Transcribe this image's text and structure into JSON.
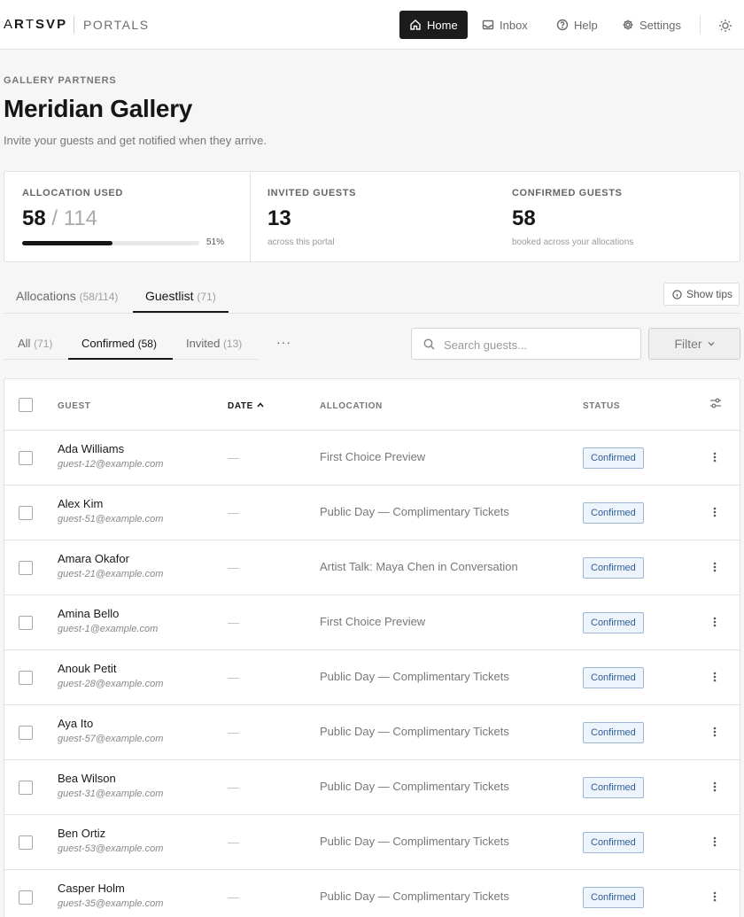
{
  "brand": {
    "logo_letters": [
      "A",
      "R",
      "T",
      "S",
      "V",
      "P"
    ],
    "portals": "PORTALS"
  },
  "nav": {
    "home": "Home",
    "inbox": "Inbox",
    "help": "Help",
    "settings": "Settings"
  },
  "header": {
    "eyebrow": "GALLERY PARTNERS",
    "title": "Meridian Gallery",
    "subtitle": "Invite your guests and get notified when they arrive."
  },
  "stats": {
    "allocation_label": "ALLOCATION USED",
    "allocation_used": "58",
    "allocation_total": "/ 114",
    "allocation_pct_label": "51%",
    "allocation_fraction": 0.51,
    "invited_label": "INVITED GUESTS",
    "invited_value": "13",
    "invited_sub": "across this portal",
    "confirmed_label": "CONFIRMED GUESTS",
    "confirmed_value": "58",
    "confirmed_sub": "booked across your allocations"
  },
  "tabs": {
    "allocations": "Allocations",
    "allocations_count": "(58/114)",
    "guestlist": "Guestlist",
    "guestlist_count": "(71)",
    "show_tips": "Show tips"
  },
  "subtabs": {
    "all": "All",
    "all_count": "(71)",
    "confirmed": "Confirmed",
    "confirmed_count": "(58)",
    "invited": "Invited",
    "invited_count": "(13)",
    "more": "···"
  },
  "search": {
    "placeholder": "Search guests..."
  },
  "filter": {
    "label": "Filter"
  },
  "table": {
    "headers": {
      "guest": "GUEST",
      "date": "DATE",
      "allocation": "ALLOCATION",
      "status": "STATUS"
    },
    "rows": [
      {
        "name": "Ada Williams",
        "email": "guest-12@example.com",
        "date": "—",
        "allocation": "First Choice Preview",
        "status": "Confirmed"
      },
      {
        "name": "Alex Kim",
        "email": "guest-51@example.com",
        "date": "—",
        "allocation": "Public Day — Complimentary Tickets",
        "status": "Confirmed"
      },
      {
        "name": "Amara Okafor",
        "email": "guest-21@example.com",
        "date": "—",
        "allocation": "Artist Talk: Maya Chen in Conversation",
        "status": "Confirmed"
      },
      {
        "name": "Amina Bello",
        "email": "guest-1@example.com",
        "date": "—",
        "allocation": "First Choice Preview",
        "status": "Confirmed"
      },
      {
        "name": "Anouk Petit",
        "email": "guest-28@example.com",
        "date": "—",
        "allocation": "Public Day — Complimentary Tickets",
        "status": "Confirmed"
      },
      {
        "name": "Aya Ito",
        "email": "guest-57@example.com",
        "date": "—",
        "allocation": "Public Day — Complimentary Tickets",
        "status": "Confirmed"
      },
      {
        "name": "Bea Wilson",
        "email": "guest-31@example.com",
        "date": "—",
        "allocation": "Public Day — Complimentary Tickets",
        "status": "Confirmed"
      },
      {
        "name": "Ben Ortiz",
        "email": "guest-53@example.com",
        "date": "—",
        "allocation": "Public Day — Complimentary Tickets",
        "status": "Confirmed"
      },
      {
        "name": "Casper Holm",
        "email": "guest-35@example.com",
        "date": "—",
        "allocation": "Public Day — Complimentary Tickets",
        "status": "Confirmed"
      }
    ]
  },
  "colors": {
    "primary": "#1c1c1c",
    "badge_border": "#9db7d6",
    "badge_bg": "#eef4fb",
    "badge_text": "#2e5e97"
  },
  "icons": [
    "home-icon",
    "inbox-icon",
    "help-icon",
    "settings-icon",
    "sun-icon",
    "info-icon",
    "search-icon",
    "chevron-down-icon",
    "sort-up-icon",
    "column-settings-icon",
    "kebab-icon"
  ]
}
